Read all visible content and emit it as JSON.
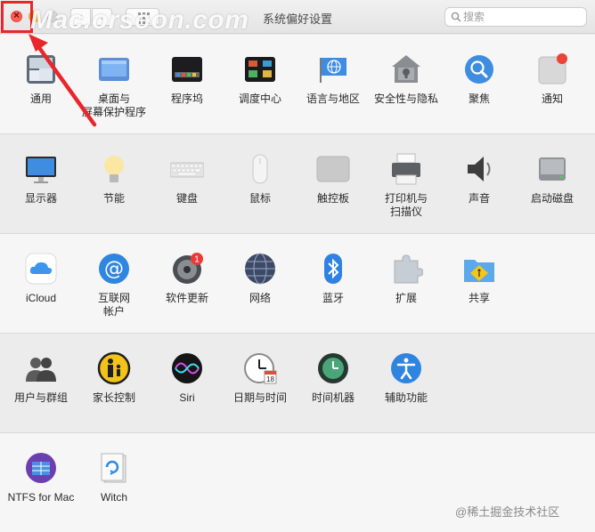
{
  "window": {
    "title": "系统偏好设置",
    "watermark": "Mac.orsoon.com"
  },
  "toolbar": {
    "back": "‹",
    "forward": "›"
  },
  "search": {
    "placeholder": "搜索"
  },
  "colors": {
    "highlight": "#e8262b",
    "close": "#fc5f57",
    "minimize": "#fdbc2e"
  },
  "rows": [
    {
      "items": [
        {
          "label": "通用",
          "icon": "general-icon"
        },
        {
          "label": "桌面与\n屏幕保护程序",
          "icon": "desktop-icon"
        },
        {
          "label": "程序坞",
          "icon": "dock-icon"
        },
        {
          "label": "调度中心",
          "icon": "mission-control-icon"
        },
        {
          "label": "语言与地区",
          "icon": "language-icon"
        },
        {
          "label": "安全性与隐私",
          "icon": "security-icon"
        },
        {
          "label": "聚焦",
          "icon": "spotlight-icon"
        },
        {
          "label": "通知",
          "icon": "notifications-icon"
        }
      ]
    },
    {
      "items": [
        {
          "label": "显示器",
          "icon": "display-icon"
        },
        {
          "label": "节能",
          "icon": "energy-icon"
        },
        {
          "label": "键盘",
          "icon": "keyboard-icon"
        },
        {
          "label": "鼠标",
          "icon": "mouse-icon"
        },
        {
          "label": "触控板",
          "icon": "trackpad-icon"
        },
        {
          "label": "打印机与\n扫描仪",
          "icon": "printer-icon"
        },
        {
          "label": "声音",
          "icon": "sound-icon"
        },
        {
          "label": "启动磁盘",
          "icon": "startup-disk-icon"
        }
      ]
    },
    {
      "items": [
        {
          "label": "iCloud",
          "icon": "icloud-icon"
        },
        {
          "label": "互联网\n帐户",
          "icon": "internet-accounts-icon"
        },
        {
          "label": "软件更新",
          "icon": "software-update-icon",
          "badge": "1"
        },
        {
          "label": "网络",
          "icon": "network-icon"
        },
        {
          "label": "蓝牙",
          "icon": "bluetooth-icon"
        },
        {
          "label": "扩展",
          "icon": "extensions-icon"
        },
        {
          "label": "共享",
          "icon": "sharing-icon"
        }
      ]
    },
    {
      "items": [
        {
          "label": "用户与群组",
          "icon": "users-icon"
        },
        {
          "label": "家长控制",
          "icon": "parental-controls-icon"
        },
        {
          "label": "Siri",
          "icon": "siri-icon"
        },
        {
          "label": "日期与时间",
          "icon": "date-time-icon",
          "date": "18"
        },
        {
          "label": "时间机器",
          "icon": "time-machine-icon"
        },
        {
          "label": "辅助功能",
          "icon": "accessibility-icon"
        }
      ]
    },
    {
      "items": [
        {
          "label": "NTFS for Mac",
          "icon": "ntfs-icon"
        },
        {
          "label": "Witch",
          "icon": "witch-icon"
        }
      ]
    }
  ],
  "footer": {
    "text": "@稀土掘金技术社区"
  }
}
